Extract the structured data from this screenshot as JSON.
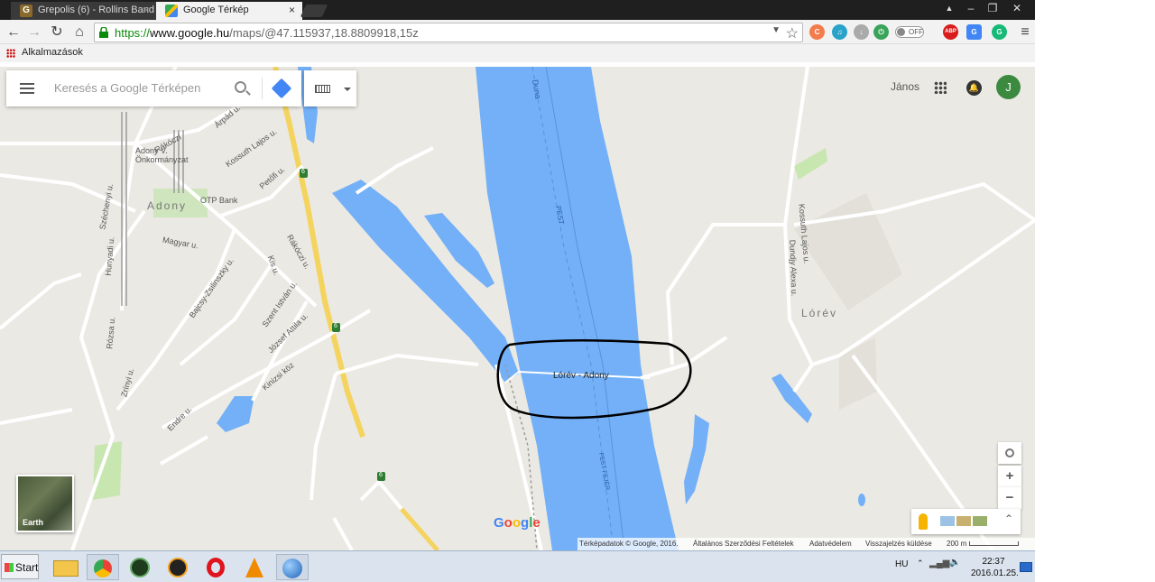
{
  "browser": {
    "tabs": [
      {
        "title": "Grepolis (6) - Rollins Band",
        "favicon": "G",
        "active": false
      },
      {
        "title": "Google Térkép",
        "favicon": "maps",
        "active": true
      }
    ],
    "url": {
      "scheme": "https://",
      "host": "www.google.hu",
      "path": "/maps/@47.115937,18.8809918,15z"
    },
    "bookmarks_label": "Alkalmazások",
    "toggle_label": "OFF",
    "ext_abp": "ABP"
  },
  "map": {
    "search_placeholder": "Keresés a Google Térképen",
    "user_name": "János",
    "avatar_initial": "J",
    "earth_label": "Earth",
    "google_logo": "Google",
    "town_labels": {
      "adony": "Adony",
      "lorev": "Lórév"
    },
    "street_labels": {
      "danube": "Duna",
      "pest": "PEST",
      "pest_fejer": "PEST FEJÉR",
      "rakoczi_top": "Rákóczi",
      "rakoczi_mid": "Rákóczi u.",
      "arpad": "Árpád u.",
      "kossuth_adony": "Kossuth Lajos u.",
      "petofi": "Petőfi u.",
      "onkormanyzat": "Adony V. Önkormányzat",
      "otp": "OTP Bank",
      "szechenyi": "Széchenyi u.",
      "hunyadi": "Hunyadi u.",
      "magyar": "Magyar u.",
      "bajcsy": "Bajcsy-Zsilinszky u.",
      "kis": "Kis u.",
      "szent_istvan": "Szent István u.",
      "jozsef_attila": "József Attila u.",
      "kinizsi": "Kinizsi köz",
      "rozsa": "Rózsa u.",
      "zrinyi": "Zrínyi u.",
      "endre": "Endre u.",
      "kossuth_lorev": "Kossuth Lajos u.",
      "dundjy": "Dundjy Alexa u."
    },
    "road_badge": "6",
    "circle_annotation": "Lórév - Adony",
    "footer": {
      "data": "Térképadatok © Google, 2016.",
      "terms": "Általános Szerződési Feltételek",
      "privacy": "Adatvédelem",
      "feedback": "Visszajelzés küldése",
      "scale": "200 m"
    },
    "zoom_in": "+",
    "zoom_out": "−",
    "colors": {
      "water": "#73b0f7",
      "land": "#ebe9e3",
      "road_major": "#f4d35e",
      "road_minor": "#ffffff",
      "park": "#c8e6b0"
    }
  },
  "taskbar": {
    "start_label": "Start",
    "language": "HU",
    "time": "22:37",
    "date": "2016.01.25."
  }
}
